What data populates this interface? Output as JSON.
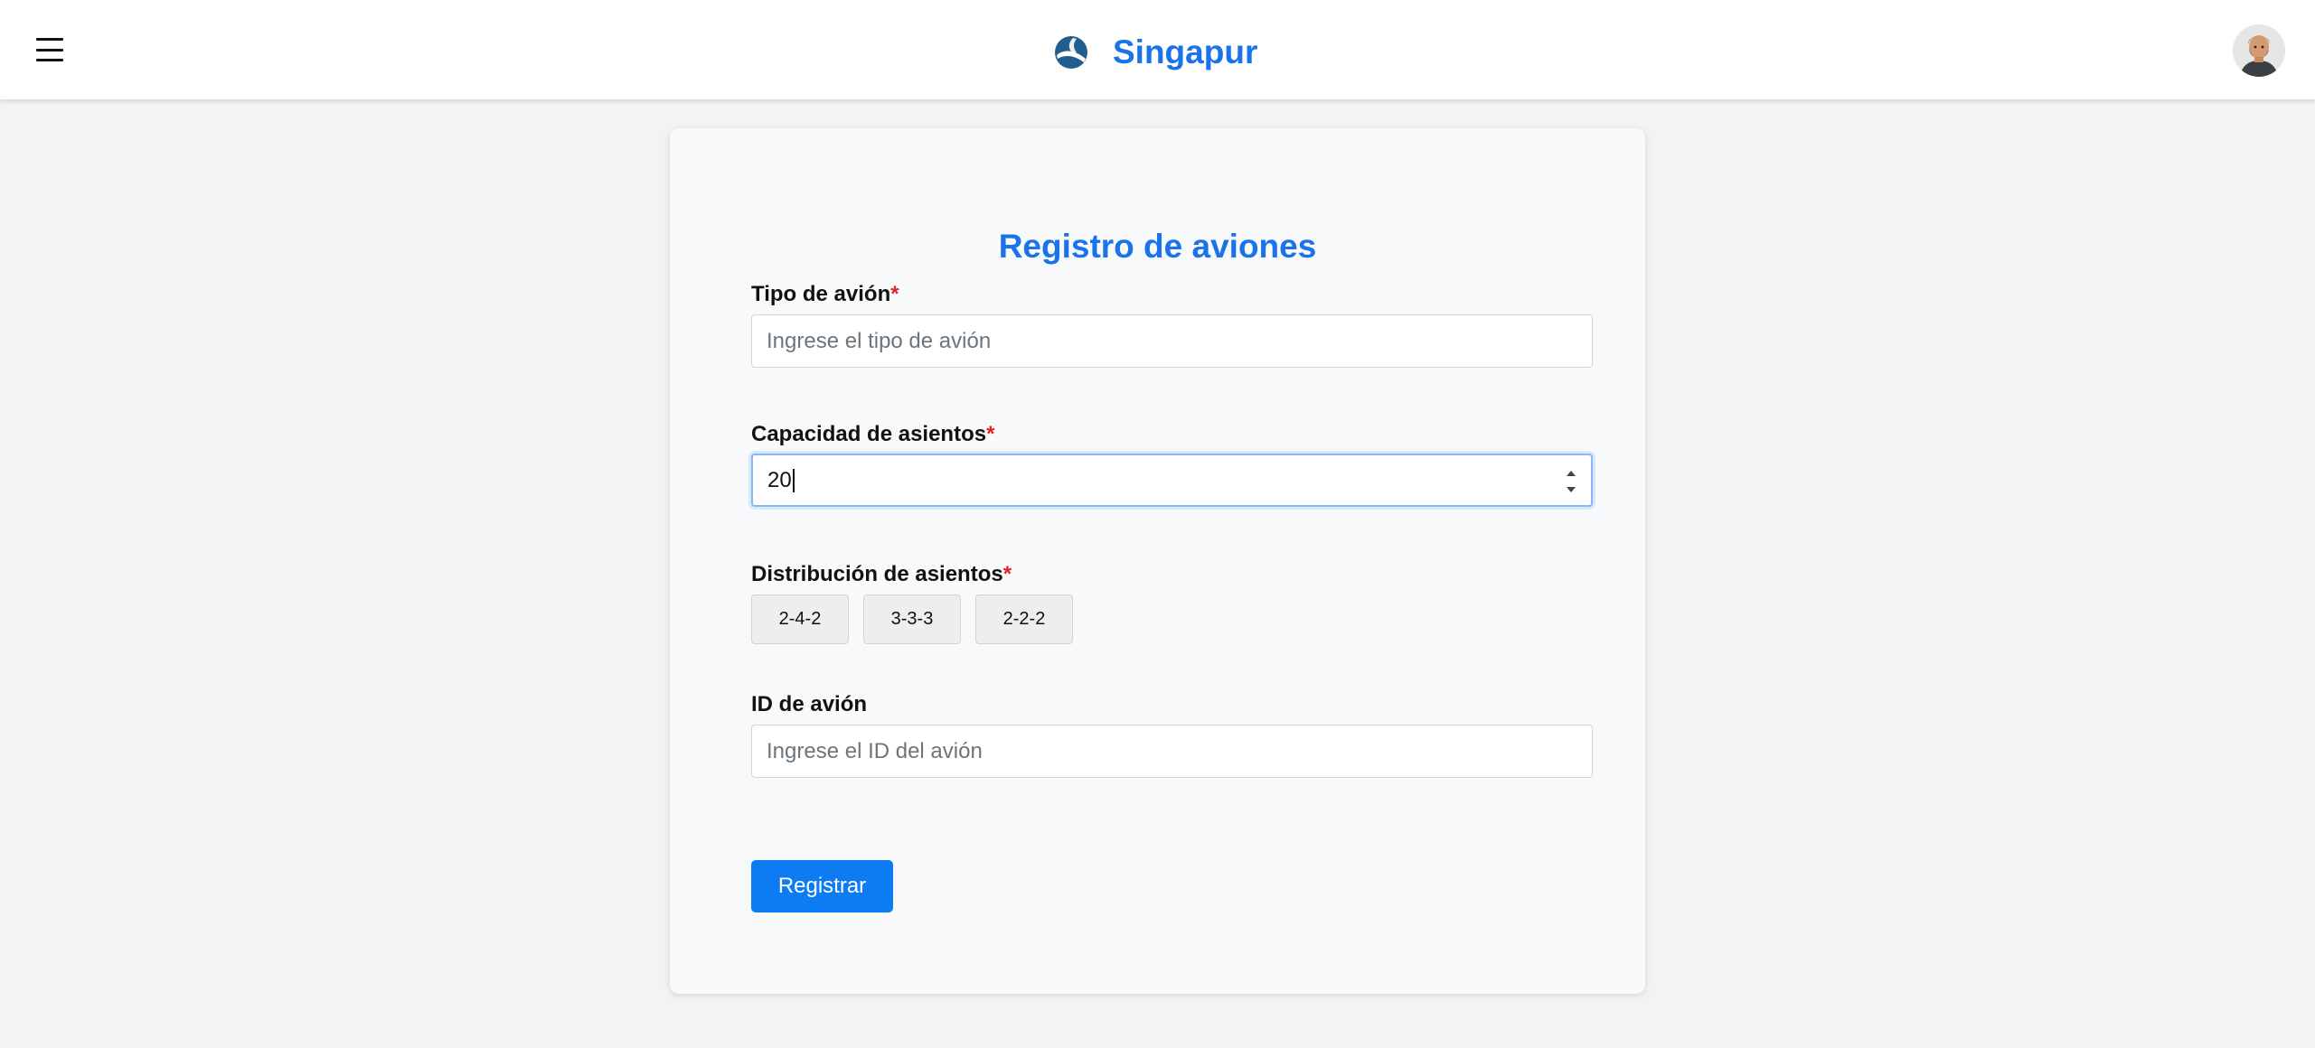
{
  "header": {
    "menu_icon": "hamburger-menu-icon",
    "logo_icon": "airline-logo-icon",
    "brand_name": "Singapur",
    "avatar": "user-avatar",
    "brand_color": "#1a73e8"
  },
  "form": {
    "title": "Registro de aviones",
    "required_marker": "*",
    "aircraft_type": {
      "label": "Tipo de avión",
      "placeholder": "Ingrese el tipo de avión",
      "value": ""
    },
    "seat_capacity": {
      "label": "Capacidad de asientos",
      "value": "20"
    },
    "seat_distribution": {
      "label": "Distribución de asientos",
      "options": [
        "2-4-2",
        "3-3-3",
        "2-2-2"
      ]
    },
    "aircraft_id": {
      "label": "ID de avión",
      "placeholder": "Ingrese el ID del avión",
      "value": ""
    },
    "submit_label": "Registrar",
    "submit_color": "#0d7cf2",
    "required_color": "#e02424"
  }
}
